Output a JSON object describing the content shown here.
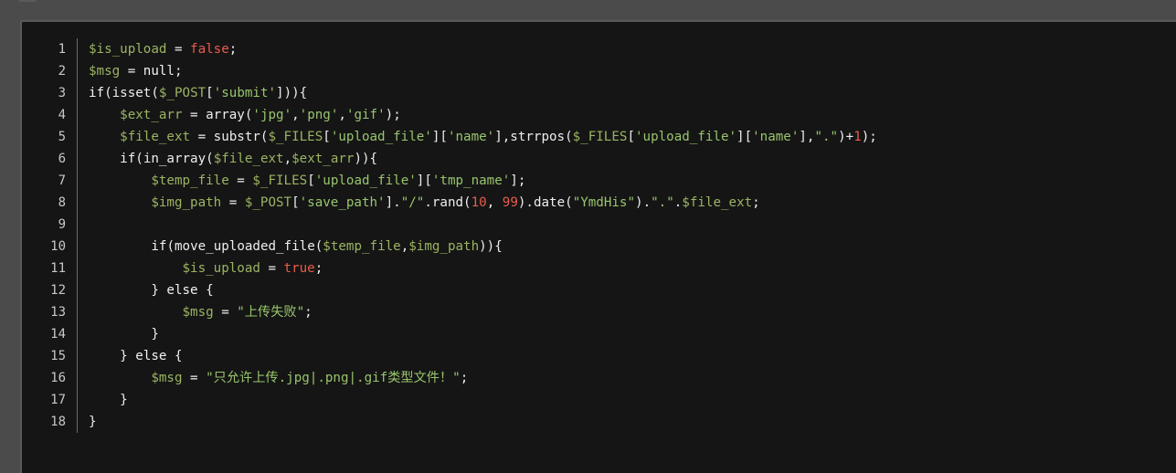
{
  "code": {
    "lines": [
      {
        "num": "1",
        "tokens": [
          {
            "t": "var",
            "v": "$is_upload"
          },
          {
            "t": "pl",
            "v": " = "
          },
          {
            "t": "lit",
            "v": "false"
          },
          {
            "t": "pl",
            "v": ";"
          }
        ]
      },
      {
        "num": "2",
        "tokens": [
          {
            "t": "var",
            "v": "$msg"
          },
          {
            "t": "pl",
            "v": " = "
          },
          {
            "t": "kw",
            "v": "null"
          },
          {
            "t": "pl",
            "v": ";"
          }
        ]
      },
      {
        "num": "3",
        "tokens": [
          {
            "t": "kw",
            "v": "if"
          },
          {
            "t": "pl",
            "v": "("
          },
          {
            "t": "fn",
            "v": "isset"
          },
          {
            "t": "pl",
            "v": "("
          },
          {
            "t": "var",
            "v": "$_POST"
          },
          {
            "t": "pl",
            "v": "["
          },
          {
            "t": "str",
            "v": "'submit'"
          },
          {
            "t": "pl",
            "v": "])){"
          }
        ]
      },
      {
        "num": "4",
        "tokens": [
          {
            "t": "pl",
            "v": "    "
          },
          {
            "t": "var",
            "v": "$ext_arr"
          },
          {
            "t": "pl",
            "v": " = "
          },
          {
            "t": "fn",
            "v": "array"
          },
          {
            "t": "pl",
            "v": "("
          },
          {
            "t": "str",
            "v": "'jpg'"
          },
          {
            "t": "pl",
            "v": ","
          },
          {
            "t": "str",
            "v": "'png'"
          },
          {
            "t": "pl",
            "v": ","
          },
          {
            "t": "str",
            "v": "'gif'"
          },
          {
            "t": "pl",
            "v": ");"
          }
        ]
      },
      {
        "num": "5",
        "tokens": [
          {
            "t": "pl",
            "v": "    "
          },
          {
            "t": "var",
            "v": "$file_ext"
          },
          {
            "t": "pl",
            "v": " = "
          },
          {
            "t": "fn",
            "v": "substr"
          },
          {
            "t": "pl",
            "v": "("
          },
          {
            "t": "var",
            "v": "$_FILES"
          },
          {
            "t": "pl",
            "v": "["
          },
          {
            "t": "str",
            "v": "'upload_file'"
          },
          {
            "t": "pl",
            "v": "]["
          },
          {
            "t": "str",
            "v": "'name'"
          },
          {
            "t": "pl",
            "v": "],"
          },
          {
            "t": "fn",
            "v": "strrpos"
          },
          {
            "t": "pl",
            "v": "("
          },
          {
            "t": "var",
            "v": "$_FILES"
          },
          {
            "t": "pl",
            "v": "["
          },
          {
            "t": "str",
            "v": "'upload_file'"
          },
          {
            "t": "pl",
            "v": "]["
          },
          {
            "t": "str",
            "v": "'name'"
          },
          {
            "t": "pl",
            "v": "],"
          },
          {
            "t": "str",
            "v": "\".\""
          },
          {
            "t": "pl",
            "v": ")+"
          },
          {
            "t": "num",
            "v": "1"
          },
          {
            "t": "pl",
            "v": ");"
          }
        ]
      },
      {
        "num": "6",
        "tokens": [
          {
            "t": "pl",
            "v": "    "
          },
          {
            "t": "kw",
            "v": "if"
          },
          {
            "t": "pl",
            "v": "("
          },
          {
            "t": "fn",
            "v": "in_array"
          },
          {
            "t": "pl",
            "v": "("
          },
          {
            "t": "var",
            "v": "$file_ext"
          },
          {
            "t": "pl",
            "v": ","
          },
          {
            "t": "var",
            "v": "$ext_arr"
          },
          {
            "t": "pl",
            "v": ")){"
          }
        ]
      },
      {
        "num": "7",
        "tokens": [
          {
            "t": "pl",
            "v": "        "
          },
          {
            "t": "var",
            "v": "$temp_file"
          },
          {
            "t": "pl",
            "v": " = "
          },
          {
            "t": "var",
            "v": "$_FILES"
          },
          {
            "t": "pl",
            "v": "["
          },
          {
            "t": "str",
            "v": "'upload_file'"
          },
          {
            "t": "pl",
            "v": "]["
          },
          {
            "t": "str",
            "v": "'tmp_name'"
          },
          {
            "t": "pl",
            "v": "];"
          }
        ]
      },
      {
        "num": "8",
        "tokens": [
          {
            "t": "pl",
            "v": "        "
          },
          {
            "t": "var",
            "v": "$img_path"
          },
          {
            "t": "pl",
            "v": " = "
          },
          {
            "t": "var",
            "v": "$_POST"
          },
          {
            "t": "pl",
            "v": "["
          },
          {
            "t": "str",
            "v": "'save_path'"
          },
          {
            "t": "pl",
            "v": "]."
          },
          {
            "t": "str",
            "v": "\"/\""
          },
          {
            "t": "pl",
            "v": "."
          },
          {
            "t": "fn",
            "v": "rand"
          },
          {
            "t": "pl",
            "v": "("
          },
          {
            "t": "num",
            "v": "10"
          },
          {
            "t": "pl",
            "v": ", "
          },
          {
            "t": "num",
            "v": "99"
          },
          {
            "t": "pl",
            "v": ")."
          },
          {
            "t": "fn",
            "v": "date"
          },
          {
            "t": "pl",
            "v": "("
          },
          {
            "t": "str",
            "v": "\"YmdHis\""
          },
          {
            "t": "pl",
            "v": ")."
          },
          {
            "t": "str",
            "v": "\".\""
          },
          {
            "t": "pl",
            "v": "."
          },
          {
            "t": "var",
            "v": "$file_ext"
          },
          {
            "t": "pl",
            "v": ";"
          }
        ]
      },
      {
        "num": "9",
        "tokens": []
      },
      {
        "num": "10",
        "tokens": [
          {
            "t": "pl",
            "v": "        "
          },
          {
            "t": "kw",
            "v": "if"
          },
          {
            "t": "pl",
            "v": "("
          },
          {
            "t": "fn",
            "v": "move_uploaded_file"
          },
          {
            "t": "pl",
            "v": "("
          },
          {
            "t": "var",
            "v": "$temp_file"
          },
          {
            "t": "pl",
            "v": ","
          },
          {
            "t": "var",
            "v": "$img_path"
          },
          {
            "t": "pl",
            "v": ")){"
          }
        ]
      },
      {
        "num": "11",
        "tokens": [
          {
            "t": "pl",
            "v": "            "
          },
          {
            "t": "var",
            "v": "$is_upload"
          },
          {
            "t": "pl",
            "v": " = "
          },
          {
            "t": "lit",
            "v": "true"
          },
          {
            "t": "pl",
            "v": ";"
          }
        ]
      },
      {
        "num": "12",
        "tokens": [
          {
            "t": "pl",
            "v": "        } "
          },
          {
            "t": "kw",
            "v": "else"
          },
          {
            "t": "pl",
            "v": " {"
          }
        ]
      },
      {
        "num": "13",
        "tokens": [
          {
            "t": "pl",
            "v": "            "
          },
          {
            "t": "var",
            "v": "$msg"
          },
          {
            "t": "pl",
            "v": " = "
          },
          {
            "t": "str",
            "v": "\"上传失败\""
          },
          {
            "t": "pl",
            "v": ";"
          }
        ]
      },
      {
        "num": "14",
        "tokens": [
          {
            "t": "pl",
            "v": "        }"
          }
        ]
      },
      {
        "num": "15",
        "tokens": [
          {
            "t": "pl",
            "v": "    } "
          },
          {
            "t": "kw",
            "v": "else"
          },
          {
            "t": "pl",
            "v": " {"
          }
        ]
      },
      {
        "num": "16",
        "tokens": [
          {
            "t": "pl",
            "v": "        "
          },
          {
            "t": "var",
            "v": "$msg"
          },
          {
            "t": "pl",
            "v": " = "
          },
          {
            "t": "str",
            "v": "\"只允许上传.jpg|.png|.gif类型文件！\""
          },
          {
            "t": "pl",
            "v": ";"
          }
        ]
      },
      {
        "num": "17",
        "tokens": [
          {
            "t": "pl",
            "v": "    }"
          }
        ]
      },
      {
        "num": "18",
        "tokens": [
          {
            "t": "pl",
            "v": "}"
          }
        ]
      }
    ]
  },
  "colors": {
    "background": "#151515",
    "variable": "#9ab462",
    "string": "#98c56c",
    "literal": "#e95c4a",
    "plain": "#ededed"
  }
}
